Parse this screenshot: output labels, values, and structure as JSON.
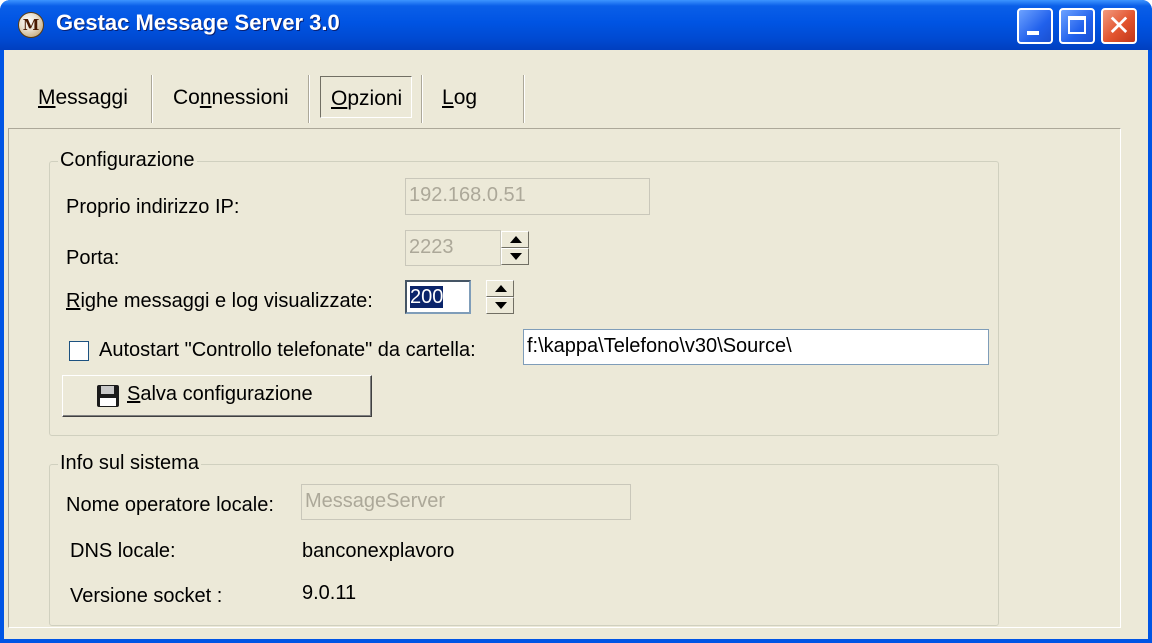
{
  "window": {
    "title": "Gestac Message Server 3.0",
    "app_icon_letter": "M"
  },
  "menu": {
    "items": [
      {
        "label": "Messaggi",
        "mnemonic": "M",
        "rest": "essaggi"
      },
      {
        "label": "Connessioni",
        "pre": "Co",
        "mnemonic": "n",
        "rest": "nessioni"
      },
      {
        "label": "Opzioni",
        "mnemonic": "O",
        "rest": "pzioni",
        "active": true
      },
      {
        "label": "Log",
        "mnemonic": "L",
        "rest": "og"
      }
    ]
  },
  "config": {
    "legend": "Configurazione",
    "ip_label": "Proprio indirizzo IP:",
    "ip_value": "192.168.0.51",
    "port_label": "Porta:",
    "port_value": "2223",
    "rows_label_mnemonic": "R",
    "rows_label_rest": "ighe messaggi e log visualizzate:",
    "rows_value": "200",
    "autostart_label": "Autostart \"Controllo telefonate\" da cartella:",
    "autostart_checked": false,
    "folder_value": "f:\\kappa\\Telefono\\v30\\Source\\",
    "save_mnemonic": "S",
    "save_rest": "alva configurazione"
  },
  "sysinfo": {
    "legend": "Info sul sistema",
    "operator_label": "Nome operatore locale:",
    "operator_value": "MessageServer",
    "dns_label": "DNS locale:",
    "dns_value": "banconexplavoro",
    "socket_label": "Versione socket :",
    "socket_value": "9.0.11"
  }
}
